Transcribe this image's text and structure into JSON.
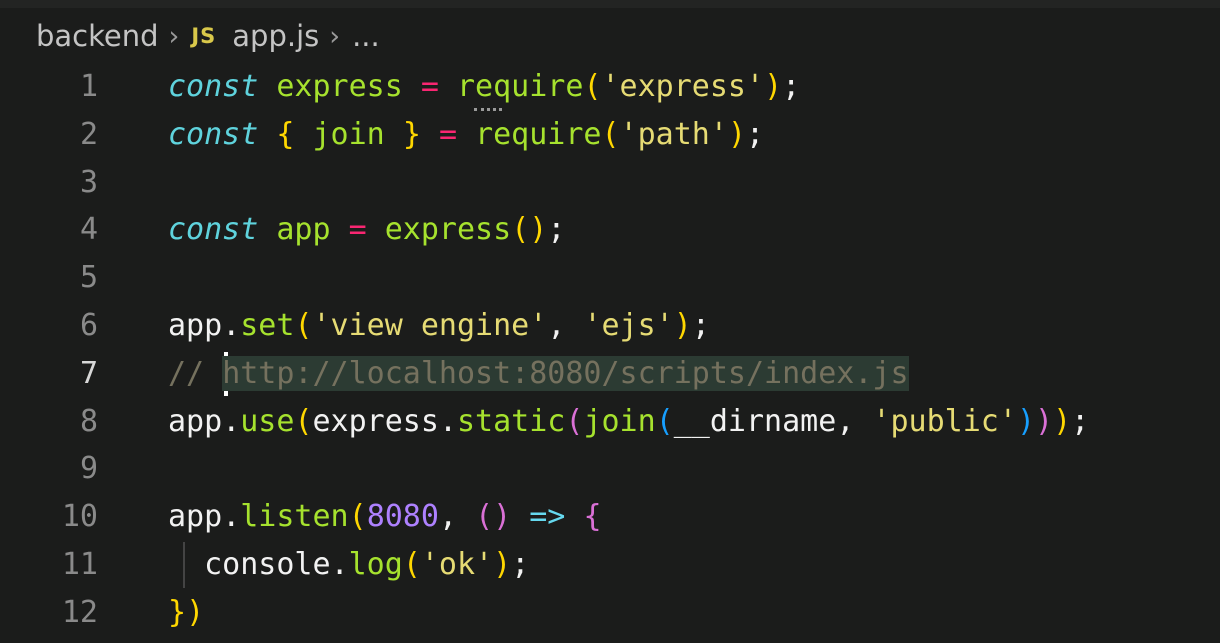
{
  "breadcrumb": {
    "folder": "backend",
    "file_icon": "JS",
    "file": "app.js",
    "more": "..."
  },
  "editor": {
    "active_line": 7,
    "line_numbers": [
      "1",
      "2",
      "3",
      "4",
      "5",
      "6",
      "7",
      "8",
      "9",
      "10",
      "11",
      "12"
    ],
    "lines": [
      "const express = require('express');",
      "const { join } = require('path');",
      "",
      "const app = express();",
      "",
      "app.set('view engine', 'ejs');",
      "// http://localhost:8080/scripts/index.js",
      "app.use(express.static(join(__dirname, 'public')));",
      "",
      "app.listen(8080, () => {",
      "  console.log('ok');",
      "})"
    ]
  },
  "colors": {
    "background": "#1b1c1b",
    "keyword": "#5fd3dd",
    "function": "#a6e22e",
    "operator": "#f92672",
    "string": "#e6db74",
    "comment": "#75715e",
    "number": "#ae81ff"
  },
  "icons": {
    "chevron": "chevron-right-icon",
    "file": "javascript-file-icon"
  }
}
